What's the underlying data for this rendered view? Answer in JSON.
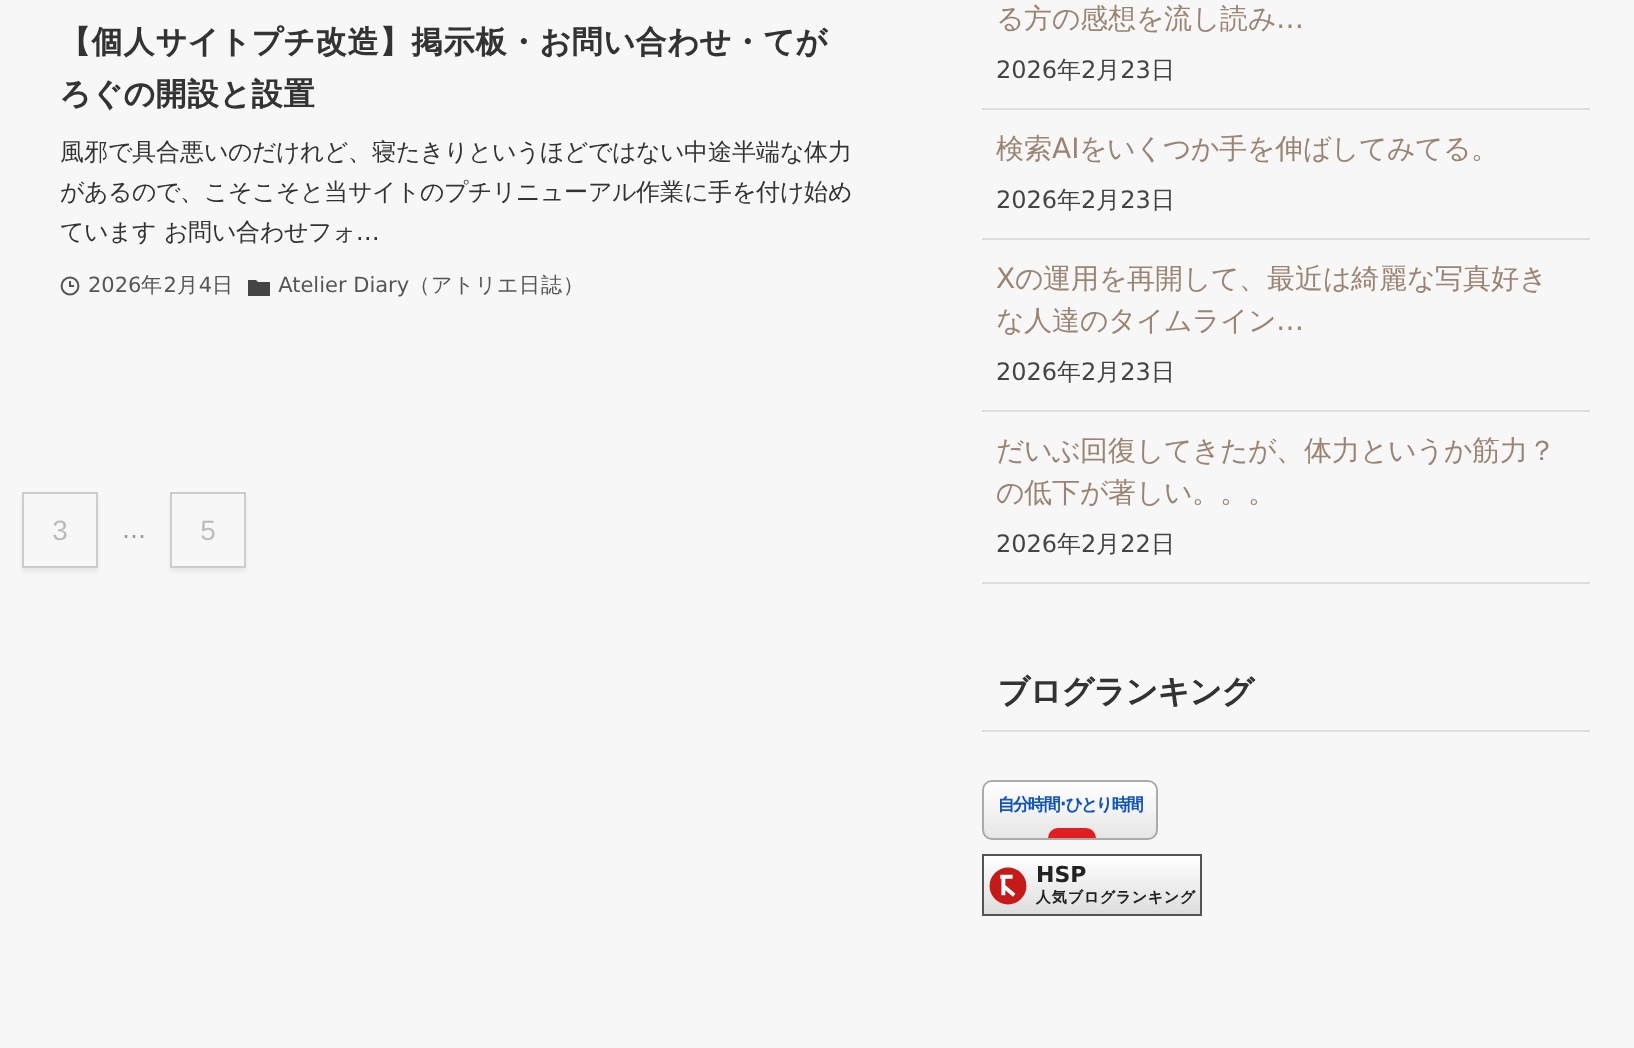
{
  "post": {
    "title": "【個人サイトプチ改造】掲示板・お問い合わせ・てがろぐの開設と設置",
    "excerpt": "風邪で具合悪いのだけれど、寝たきりというほどではない中途半端な体力があるので、こそこそと当サイトのプチリニューアル作業に手を付け始めています お問い合わせフォ…",
    "date": "2026年2月4日",
    "category": "Atelier Diary（アトリエ日誌）"
  },
  "pagination": [
    {
      "kind": "page",
      "label": "3"
    },
    {
      "kind": "dots",
      "label": "…"
    },
    {
      "kind": "page",
      "label": "5"
    }
  ],
  "recent_posts": [
    {
      "title": "る方の感想を流し読み…",
      "date": "2026年2月23日"
    },
    {
      "title": "検索AIをいくつか手を伸ばしてみてる。",
      "date": "2026年2月23日"
    },
    {
      "title": "Xの運用を再開して、最近は綺麗な写真好きな人達のタイムライン…",
      "date": "2026年2月23日"
    },
    {
      "title": "だいぶ回復してきたが、体力というか筋力？の低下が著しい。。。",
      "date": "2026年2月22日"
    }
  ],
  "ranking": {
    "heading": "ブログランキング",
    "banners": [
      {
        "kind": "jibun",
        "text": "自分時間･ひとり時間"
      },
      {
        "kind": "hsp",
        "title": "HSP",
        "text": "人気ブログランキング"
      }
    ]
  }
}
